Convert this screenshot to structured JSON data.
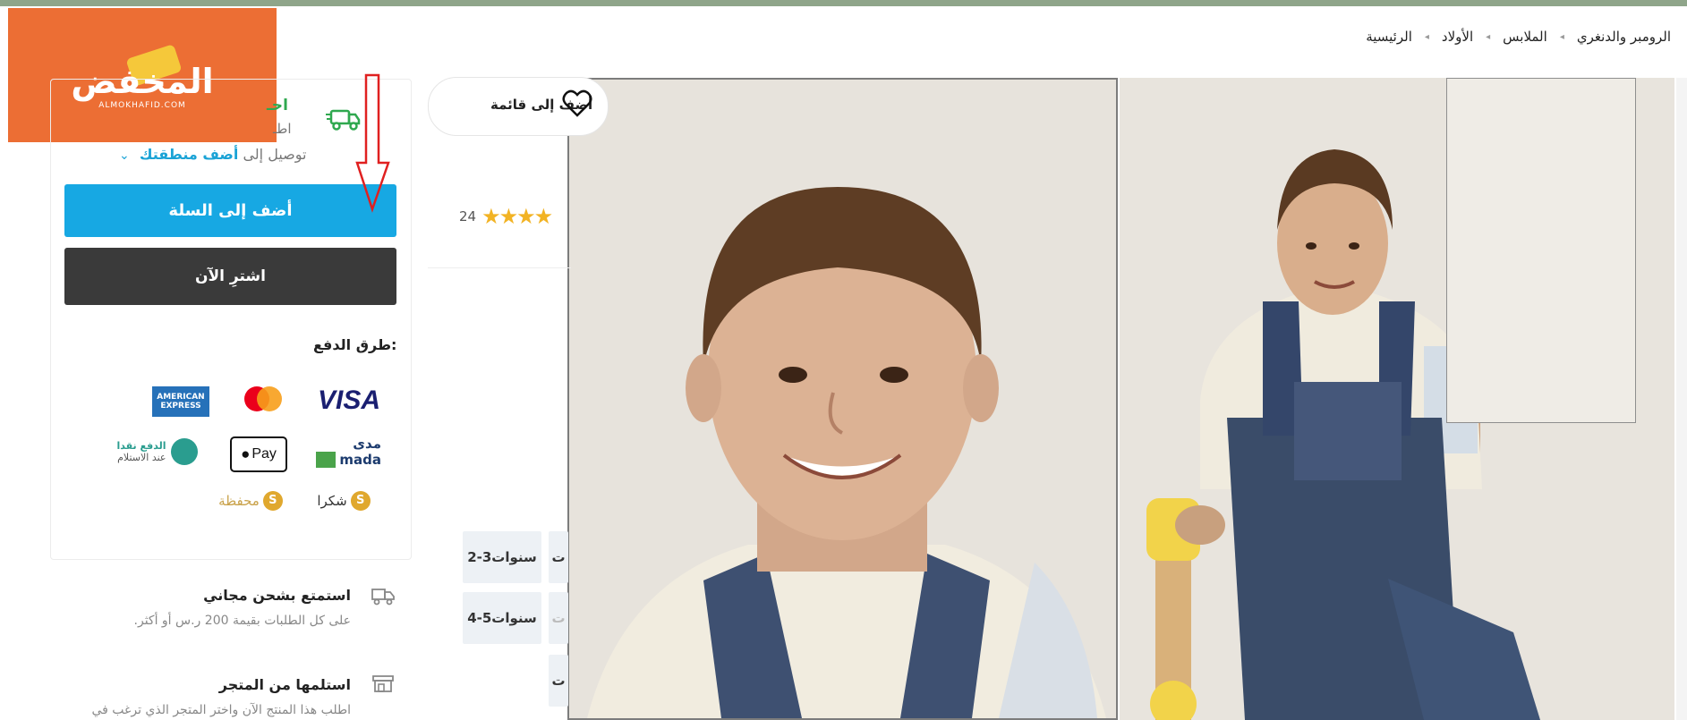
{
  "breadcrumb": [
    "الرئيسية",
    "الأولاد",
    "الملابس",
    "الرومبر والدنغري"
  ],
  "logo": {
    "name": "المخفض",
    "sub": "ALMOKHAFID.COM"
  },
  "delivery": {
    "heading": "احـ",
    "subtext": "اطـ",
    "to_label": "توصيل إلى",
    "area_link": "أضف منطقتك"
  },
  "actions": {
    "add_to_cart": "أضف إلى السلة",
    "buy_now": "اشترِ الآن"
  },
  "payment": {
    "title": "طرق الدفع:",
    "methods": {
      "visa": "VISA",
      "mastercard": "mastercard",
      "amex_line1": "AMERICAN",
      "amex_line2": "EXPRESS",
      "mada_ar": "مدى",
      "mada_en": "mada",
      "applepay": "Pay",
      "cod_line1": "الدفع نقدا",
      "cod_line2": "عند الاستلام",
      "shukra": "شكرا",
      "mahfaza": "محفظة",
      "coin": "S"
    }
  },
  "perks": [
    {
      "title": "استمتع بشحن مجاني",
      "subtitle": "على كل الطلبات بقيمة 200 ر.س أو أكثر."
    },
    {
      "title": "استلمها من المتجر",
      "subtitle": "اطلب هذا المنتج الآن واختر المتجر الذي ترغب في"
    }
  ],
  "wishlist": {
    "label": "أضف إلى قائمة"
  },
  "rating": {
    "count": "24",
    "stars_shown": 4
  },
  "sizes": {
    "s1": "2-3سنوات",
    "s2": "4-5سنوات",
    "partial": "ت"
  },
  "colors": {
    "accent": "#17a8e3",
    "dark_button": "#3a3a3a",
    "delivery_green": "#2fa84f",
    "logo_orange": "#ec6e34",
    "annotation_red": "#e02020"
  },
  "icons": {
    "truck": "delivery-truck-icon",
    "heart": "heart-icon",
    "store": "store-icon",
    "shipping": "shipping-truck-icon",
    "chevron": "chevron-down-icon",
    "arrow": "red-arrow-annotation"
  }
}
